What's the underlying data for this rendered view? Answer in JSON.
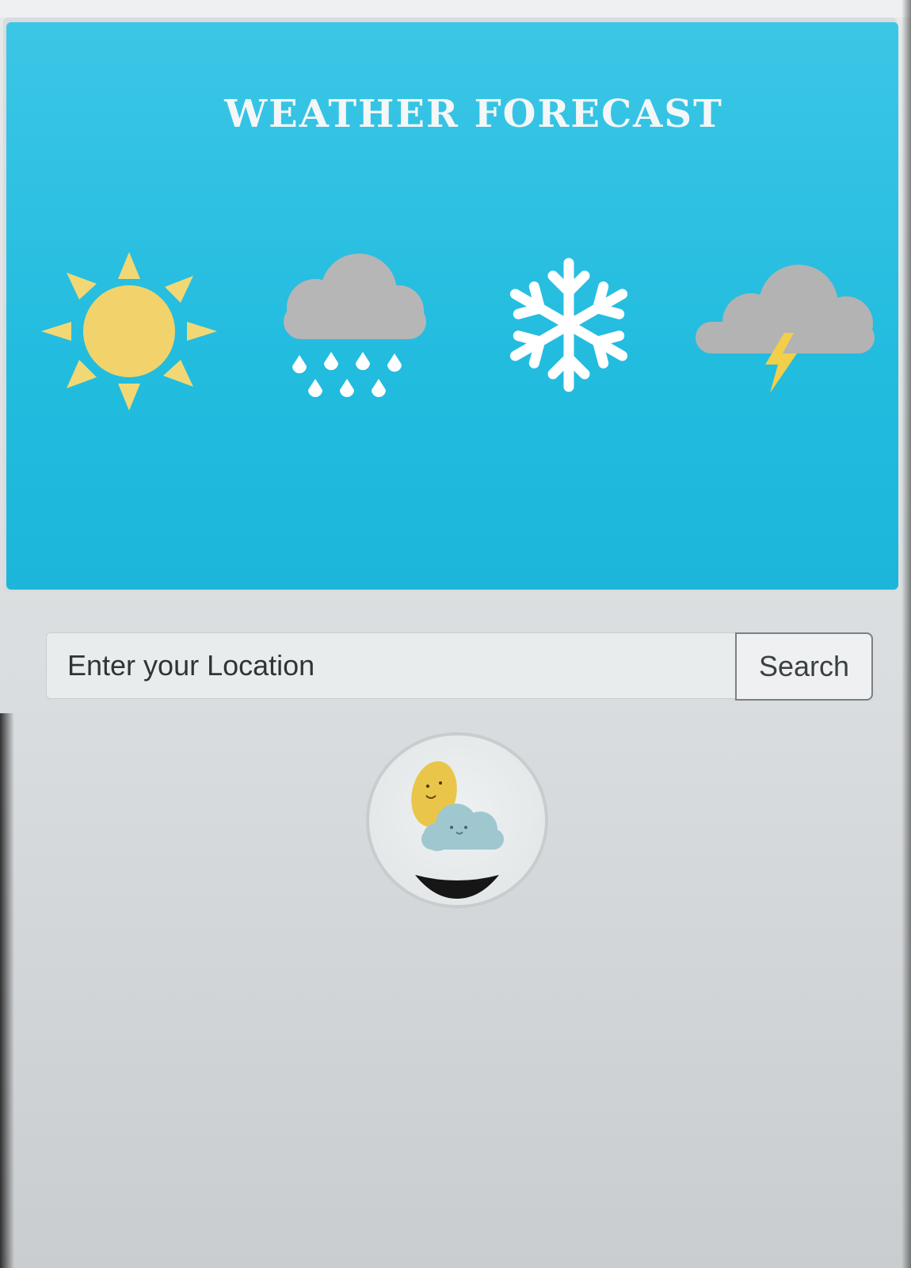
{
  "banner": {
    "title": "WEATHER FORECAST",
    "icons": [
      "sun-icon",
      "rain-cloud-icon",
      "snowflake-icon",
      "thunderstorm-icon"
    ],
    "background_color": "#22bcdf"
  },
  "search": {
    "placeholder": "Enter your Location",
    "value": "",
    "button_label": "Search"
  },
  "loader": {
    "icon": "sun-behind-cloud-loading-icon"
  }
}
